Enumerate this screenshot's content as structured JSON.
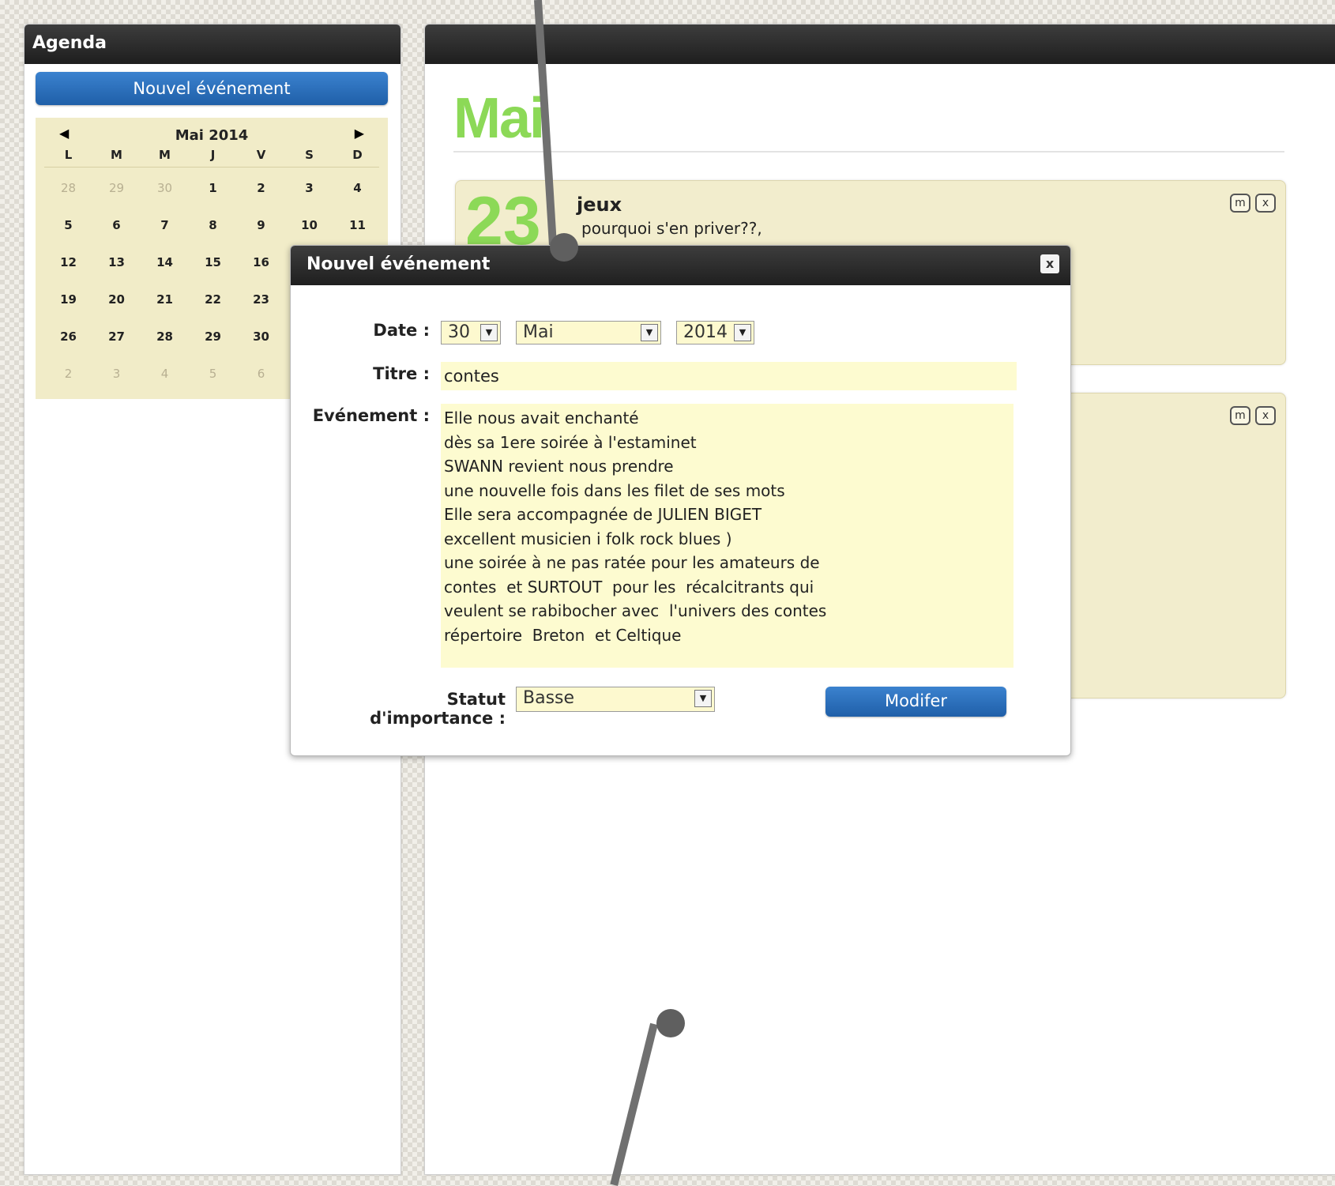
{
  "agenda": {
    "title": "Agenda",
    "new_event_button": "Nouvel événement",
    "calendar": {
      "prev_label": "◀",
      "next_label": "▶",
      "title": "Mai 2014",
      "weekdays": [
        "L",
        "M",
        "M",
        "J",
        "V",
        "S",
        "D"
      ],
      "weeks": [
        [
          {
            "d": "28",
            "m": true
          },
          {
            "d": "29",
            "m": true
          },
          {
            "d": "30",
            "m": true
          },
          {
            "d": "1"
          },
          {
            "d": "2"
          },
          {
            "d": "3"
          },
          {
            "d": "4"
          }
        ],
        [
          {
            "d": "5"
          },
          {
            "d": "6"
          },
          {
            "d": "7"
          },
          {
            "d": "8"
          },
          {
            "d": "9"
          },
          {
            "d": "10"
          },
          {
            "d": "11"
          }
        ],
        [
          {
            "d": "12"
          },
          {
            "d": "13"
          },
          {
            "d": "14"
          },
          {
            "d": "15"
          },
          {
            "d": "16"
          }
        ],
        [
          {
            "d": "19"
          },
          {
            "d": "20"
          },
          {
            "d": "21"
          },
          {
            "d": "22"
          },
          {
            "d": "23"
          }
        ],
        [
          {
            "d": "26"
          },
          {
            "d": "27"
          },
          {
            "d": "28"
          },
          {
            "d": "29"
          },
          {
            "d": "30"
          }
        ],
        [
          {
            "d": "2",
            "m": true
          },
          {
            "d": "3",
            "m": true
          },
          {
            "d": "4",
            "m": true
          },
          {
            "d": "5",
            "m": true
          },
          {
            "d": "6",
            "m": true
          }
        ]
      ]
    }
  },
  "main": {
    "month": "Mai",
    "events": [
      {
        "day": "23",
        "title": "jeux",
        "description": "pourquoi s'en priver??,",
        "edit_label": "m",
        "delete_label": "x"
      },
      {
        "edit_label": "m",
        "delete_label": "x"
      }
    ]
  },
  "dialog": {
    "title": "Nouvel événement",
    "close_label": "x",
    "date_label": "Date :",
    "date_day": "30",
    "date_month": "Mai",
    "date_year": "2014",
    "title_label": "Titre :",
    "title_value": "contes",
    "event_label": "Evénement :",
    "event_lines": [
      "Elle nous avait enchanté",
      "dès sa 1ere soirée à l'estaminet",
      "SWANN revient nous prendre",
      "une nouvelle fois dans les filet de ses mots",
      "Elle sera accompagnée de JULIEN BIGET",
      "excellent musicien i folk rock blues )",
      "une soirée à ne pas ratée pour les amateurs de",
      "contes  et SURTOUT  pour les  récalcitrants qui",
      "veulent se rabibocher avec  l'univers des contes",
      "répertoire  Breton  et Celtique"
    ],
    "status_label": "Statut d'importance :",
    "status_value": "Basse",
    "submit_label": "Modifer",
    "dropdown_icon": "▼"
  },
  "colors": {
    "accent_green": "#8cd957",
    "button_blue": "#2a6fbe",
    "card_bg": "#f2edcd",
    "field_bg": "#fdfbd0",
    "header_dark": "#2b2b2b"
  }
}
